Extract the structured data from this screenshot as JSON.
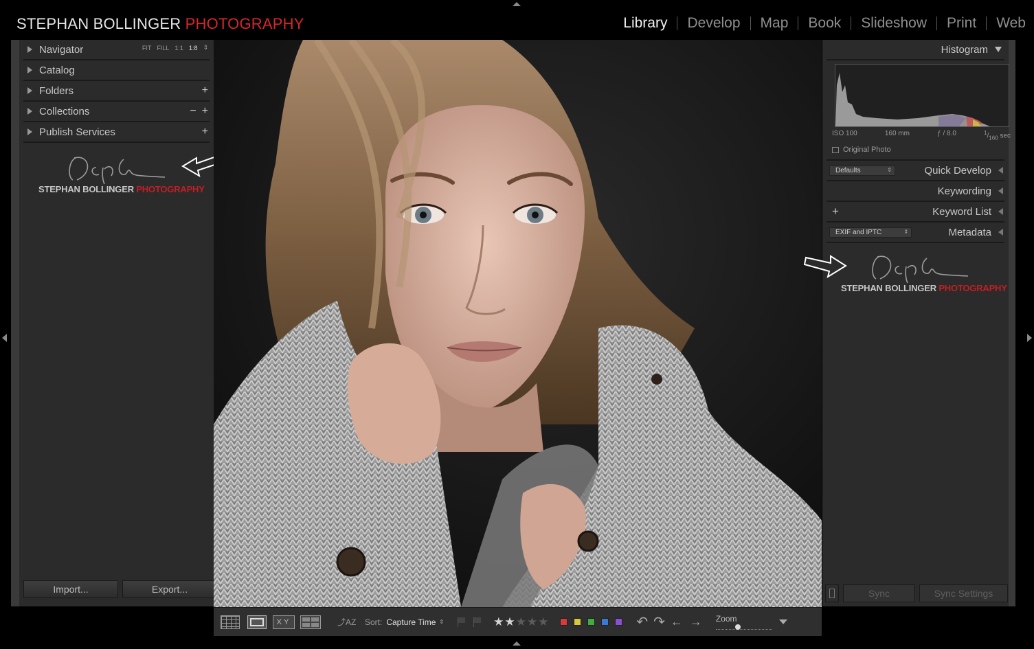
{
  "identity_plate": {
    "name": "STEPHAN BOLLINGER",
    "accent": "PHOTOGRAPHY",
    "accent_color": "#d8262c"
  },
  "modules": [
    {
      "label": "Library",
      "active": true
    },
    {
      "label": "Develop",
      "active": false
    },
    {
      "label": "Map",
      "active": false
    },
    {
      "label": "Book",
      "active": false
    },
    {
      "label": "Slideshow",
      "active": false
    },
    {
      "label": "Print",
      "active": false
    },
    {
      "label": "Web",
      "active": false
    }
  ],
  "left_panel": {
    "navigator": {
      "label": "Navigator",
      "zoom_options": [
        "FIT",
        "FILL",
        "1:1",
        "1:8"
      ],
      "selected_zoom": "1:8"
    },
    "catalog": {
      "label": "Catalog"
    },
    "folders": {
      "label": "Folders"
    },
    "collections": {
      "label": "Collections"
    },
    "publish": {
      "label": "Publish Services"
    },
    "watermark": {
      "name": "STEPHAN BOLLINGER",
      "accent": "PHOTOGRAPHY"
    },
    "import_label": "Import...",
    "export_label": "Export..."
  },
  "right_panel": {
    "histogram": {
      "label": "Histogram",
      "iso": "ISO 100",
      "focal": "160 mm",
      "aperture": "ƒ / 8.0",
      "shutter_num": "1",
      "shutter_den": "160",
      "shutter_unit": "sec",
      "original_photo": "Original Photo"
    },
    "quick_develop": {
      "label": "Quick Develop",
      "preset": "Defaults"
    },
    "keywording": {
      "label": "Keywording"
    },
    "keyword_list": {
      "label": "Keyword List"
    },
    "metadata": {
      "label": "Metadata",
      "preset": "EXIF and IPTC"
    },
    "watermark": {
      "name": "STEPHAN BOLLINGER",
      "accent": "PHOTOGRAPHY"
    },
    "sync_label": "Sync",
    "sync_settings_label": "Sync Settings"
  },
  "toolbar": {
    "sort_label": "Sort:",
    "sort_value": "Capture Time",
    "rating": 2,
    "rating_max": 5,
    "color_labels": [
      "#d63a3a",
      "#d6c93a",
      "#3fae3f",
      "#3a7ad6",
      "#8a4fd6"
    ],
    "zoom_label": "Zoom",
    "zoom_level": 0.38
  }
}
